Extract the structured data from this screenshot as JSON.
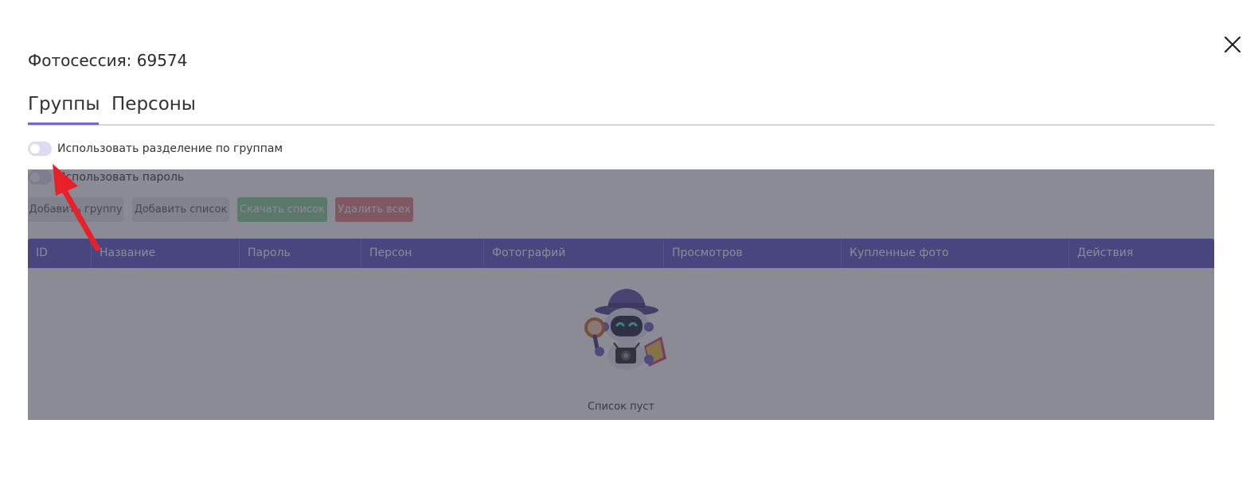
{
  "modal": {
    "title": "Фотосессия: 69574",
    "close_icon": "close-icon"
  },
  "tabs": [
    {
      "label": "Группы",
      "active": true
    },
    {
      "label": "Персоны",
      "active": false
    }
  ],
  "toggles": {
    "groups_split": {
      "label": "Использовать разделение по группам",
      "on": false
    },
    "password": {
      "label": "Использовать пароль",
      "on": false
    }
  },
  "buttons": {
    "add_group": "Добавить группу",
    "add_list": "Добавить список",
    "download_list": "Скачать список",
    "delete_all": "Удалить всех"
  },
  "table": {
    "columns": [
      "ID",
      "Название",
      "Пароль",
      "Персон",
      "Фотографий",
      "Просмотров",
      "Купленные фото",
      "Действия"
    ],
    "rows": []
  },
  "empty_state": {
    "text": "Список пуст",
    "illustration": "detective-robot-icon"
  },
  "colors": {
    "accent": "#5c53c9",
    "success": "#88d197",
    "danger": "#e37f7f",
    "arrow": "#e8202a"
  }
}
